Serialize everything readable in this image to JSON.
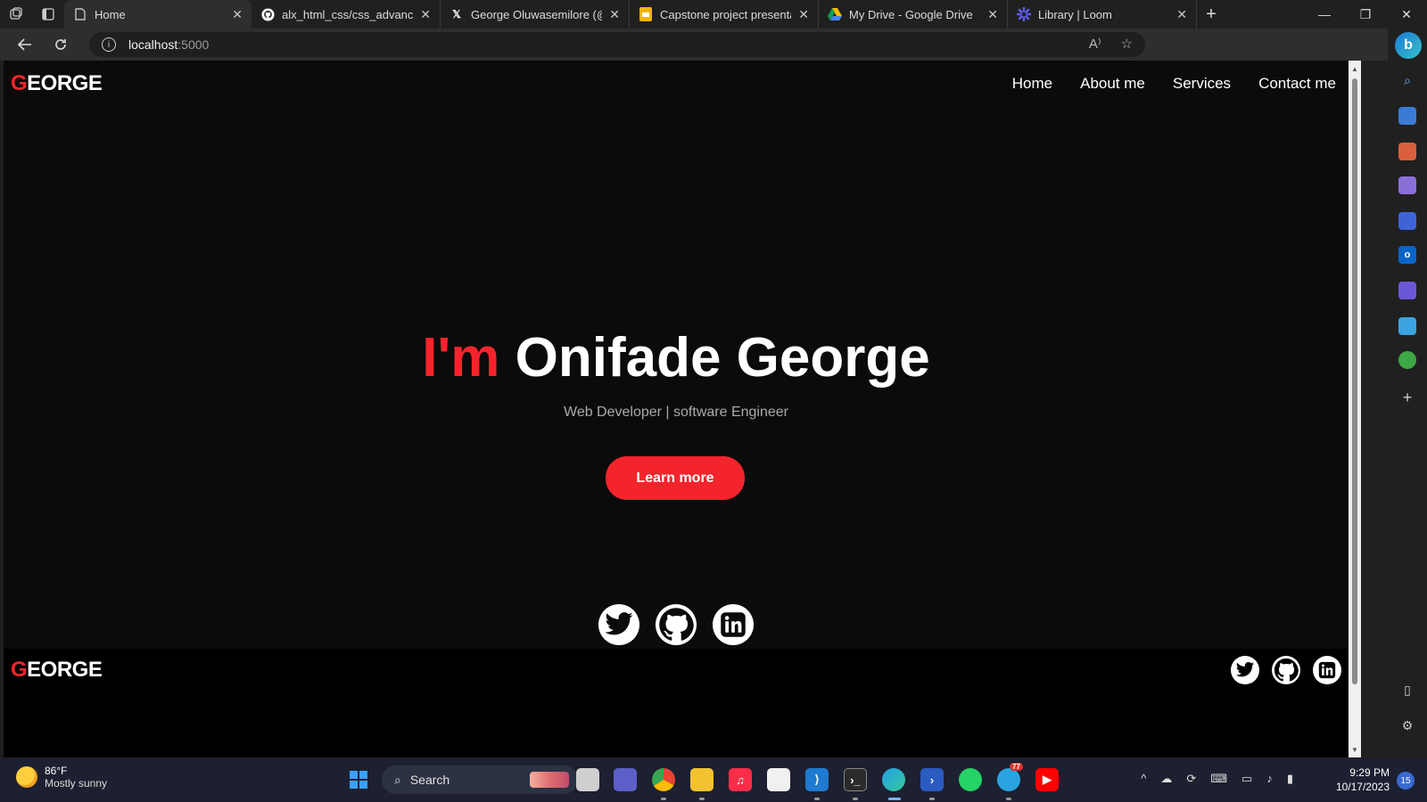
{
  "browser": {
    "tabs": [
      {
        "title": "Home",
        "icon": "page-icon",
        "active": true
      },
      {
        "title": "alx_html_css/css_advanced a",
        "icon": "github-icon",
        "active": false
      },
      {
        "title": "George Oluwasemilore (@Se",
        "icon": "x-icon",
        "active": false
      },
      {
        "title": "Capstone project presentatio",
        "icon": "slides-icon",
        "active": false
      },
      {
        "title": "My Drive - Google Drive",
        "icon": "drive-icon",
        "active": false
      },
      {
        "title": "Library | Loom",
        "icon": "loom-icon",
        "active": false
      }
    ],
    "url_host": "localhost",
    "url_port": ":5000",
    "read_aloud_label": "A⁾"
  },
  "site": {
    "logo_first": "G",
    "logo_rest": "EORGE",
    "nav": [
      "Home",
      "About me",
      "Services",
      "Contact me"
    ],
    "hero_prefix": "I'm",
    "hero_name": "Onifade George",
    "hero_subtitle": "Web Developer | software Engineer",
    "cta_label": "Learn more",
    "accent": "#f5242c",
    "footer_logo_first": "G",
    "footer_logo_rest": "EORGE"
  },
  "taskbar": {
    "temperature": "86°F",
    "weather": "Mostly sunny",
    "search_label": "Search",
    "telegram_badge": "77",
    "time": "9:29 PM",
    "date": "10/17/2023",
    "notifications": "15"
  }
}
